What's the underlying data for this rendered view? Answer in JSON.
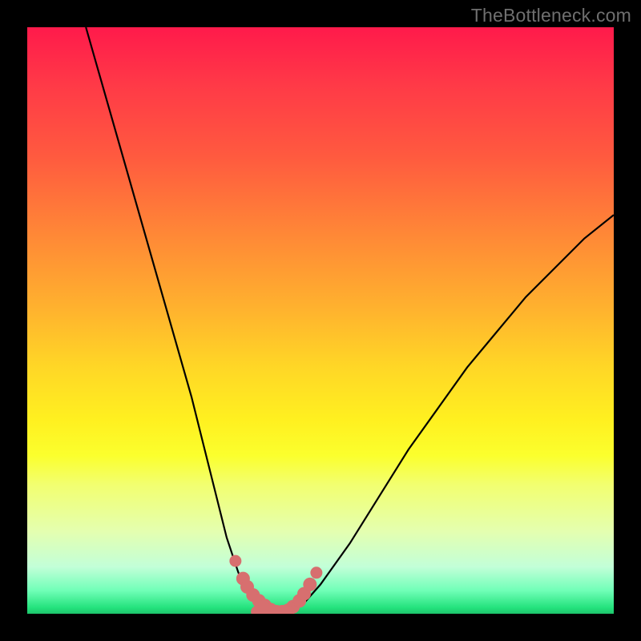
{
  "watermark": "TheBottleneck.com",
  "chart_data": {
    "type": "line",
    "title": "",
    "xlabel": "",
    "ylabel": "",
    "xlim": [
      0,
      100
    ],
    "ylim": [
      0,
      100
    ],
    "grid": false,
    "legend": false,
    "series": [
      {
        "name": "bottleneck-curve",
        "x": [
          10,
          12,
          14,
          16,
          18,
          20,
          22,
          24,
          26,
          28,
          30,
          32,
          33,
          34,
          35,
          36,
          37,
          38,
          39,
          40,
          41,
          42,
          43,
          44,
          45,
          47,
          50,
          55,
          60,
          65,
          70,
          75,
          80,
          85,
          90,
          95,
          100
        ],
        "y": [
          100,
          93,
          86,
          79,
          72,
          65,
          58,
          51,
          44,
          37,
          29,
          21,
          17,
          13,
          10,
          7,
          5,
          3.5,
          2.3,
          1.4,
          0.8,
          0.4,
          0.15,
          0.15,
          0.4,
          1.6,
          5,
          12,
          20,
          28,
          35,
          42,
          48,
          54,
          59,
          64,
          68
        ]
      }
    ],
    "markers": {
      "name": "optimal-region-markers",
      "x": [
        35.5,
        36.8,
        37.5,
        38.5,
        39.5,
        40.5,
        41.5,
        42.5,
        43.5,
        44.5,
        45.3,
        46.4,
        47.2,
        48.2,
        49.3
      ],
      "y": [
        9.0,
        6.0,
        4.6,
        3.2,
        2.2,
        1.4,
        0.7,
        0.35,
        0.35,
        0.6,
        1.2,
        2.2,
        3.4,
        5.0,
        7.0
      ]
    },
    "bottom_bar": {
      "x_start": 38.2,
      "x_end": 45.4,
      "y": 0.2
    }
  }
}
